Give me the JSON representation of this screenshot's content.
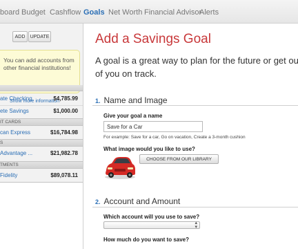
{
  "nav": {
    "items": [
      {
        "label": "board",
        "active": false
      },
      {
        "label": "Budget",
        "active": false
      },
      {
        "label": "Cashflow",
        "active": false
      },
      {
        "label": "Goals",
        "active": true
      },
      {
        "label": "Net Worth",
        "active": false
      },
      {
        "label": "Financial Advisor",
        "active": false
      },
      {
        "label": "Alerts",
        "active": false
      }
    ]
  },
  "sidebar": {
    "add_label": "ADD",
    "update_label": "UPDATE",
    "notice": "You can add accounts from other financial institutions!",
    "more_info": "Show more information",
    "accounts": [
      {
        "name": "ate Checking",
        "amount": "$4,785.99"
      },
      {
        "name": "ete Savings",
        "amount": "$1,000.00"
      },
      {
        "name": "can Express",
        "amount": "$16,784.98"
      },
      {
        "name": "Advantage ...",
        "amount": "$21,982.78"
      },
      {
        "name": "Fidelity",
        "amount": "$89,078.11"
      }
    ],
    "sections": [
      "IT CARDS",
      "S",
      "TMENTS"
    ]
  },
  "main": {
    "title": "Add a Savings Goal",
    "lead": "A goal is a great way to plan for the future or get out of you on track.",
    "section1": {
      "number": "1.",
      "title": "Name and Image",
      "name_label": "Give your goal a name",
      "name_value": "Save for a Car",
      "example": "For example: Save for a car, Go on vacation, Create a 3-month cushion",
      "image_label": "What image would you like to use?",
      "library_button": "CHOOSE FROM OUR LIBRARY"
    },
    "section2": {
      "number": "2.",
      "title": "Account and Amount",
      "account_label": "Which account will you use to save?",
      "amount_label": "How much do you want to save?"
    }
  },
  "colors": {
    "accent": "#2a6eb5",
    "title": "#c8383a",
    "notice_bg": "#fdfbd6",
    "car": "#d42a25"
  }
}
